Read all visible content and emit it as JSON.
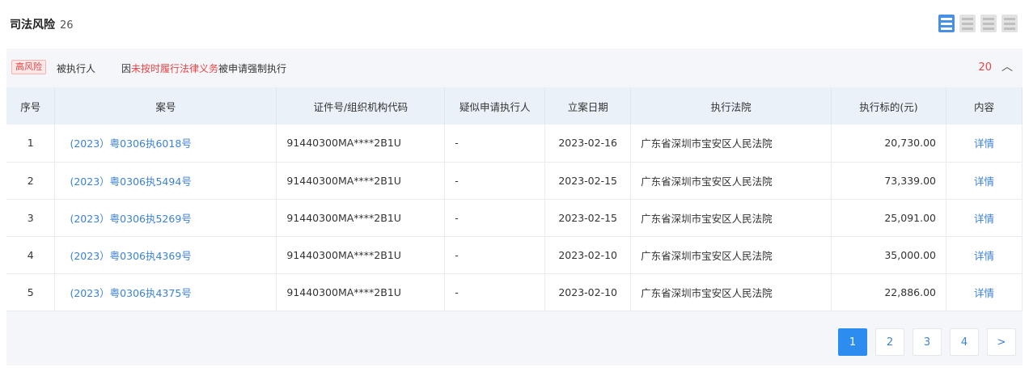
{
  "header": {
    "title": "司法风险",
    "count": "26"
  },
  "risk": {
    "tag": "高风险",
    "who": "被执行人",
    "desc_prefix": "因",
    "desc_highlight": "未按时履行法律义务",
    "desc_suffix": "被申请强制执行",
    "count": "20",
    "toggle": "︿"
  },
  "table": {
    "headers": [
      "序号",
      "案号",
      "证件号/组织机构代码",
      "疑似申请执行人",
      "立案日期",
      "执行法院",
      "执行标的(元)",
      "内容"
    ],
    "rows": [
      {
        "index": "1",
        "case": "(2023）粤0306执6018号",
        "id": "91440300MA****2B1U",
        "applicant": "-",
        "date": "2023-02-16",
        "court": "广东省深圳市宝安区人民法院",
        "amount": "20,730.00",
        "detail": "详情"
      },
      {
        "index": "2",
        "case": "(2023）粤0306执5494号",
        "id": "91440300MA****2B1U",
        "applicant": "-",
        "date": "2023-02-15",
        "court": "广东省深圳市宝安区人民法院",
        "amount": "73,339.00",
        "detail": "详情"
      },
      {
        "index": "3",
        "case": "(2023）粤0306执5269号",
        "id": "91440300MA****2B1U",
        "applicant": "-",
        "date": "2023-02-15",
        "court": "广东省深圳市宝安区人民法院",
        "amount": "25,091.00",
        "detail": "详情"
      },
      {
        "index": "4",
        "case": "(2023）粤0306执4369号",
        "id": "91440300MA****2B1U",
        "applicant": "-",
        "date": "2023-02-10",
        "court": "广东省深圳市宝安区人民法院",
        "amount": "35,000.00",
        "detail": "详情"
      },
      {
        "index": "5",
        "case": "(2023）粤0306执4375号",
        "id": "91440300MA****2B1U",
        "applicant": "-",
        "date": "2023-02-10",
        "court": "广东省深圳市宝安区人民法院",
        "amount": "22,886.00",
        "detail": "详情"
      }
    ]
  },
  "pagination": {
    "pages": [
      "1",
      "2",
      "3",
      "4"
    ],
    "current": "1",
    "next": ">"
  }
}
